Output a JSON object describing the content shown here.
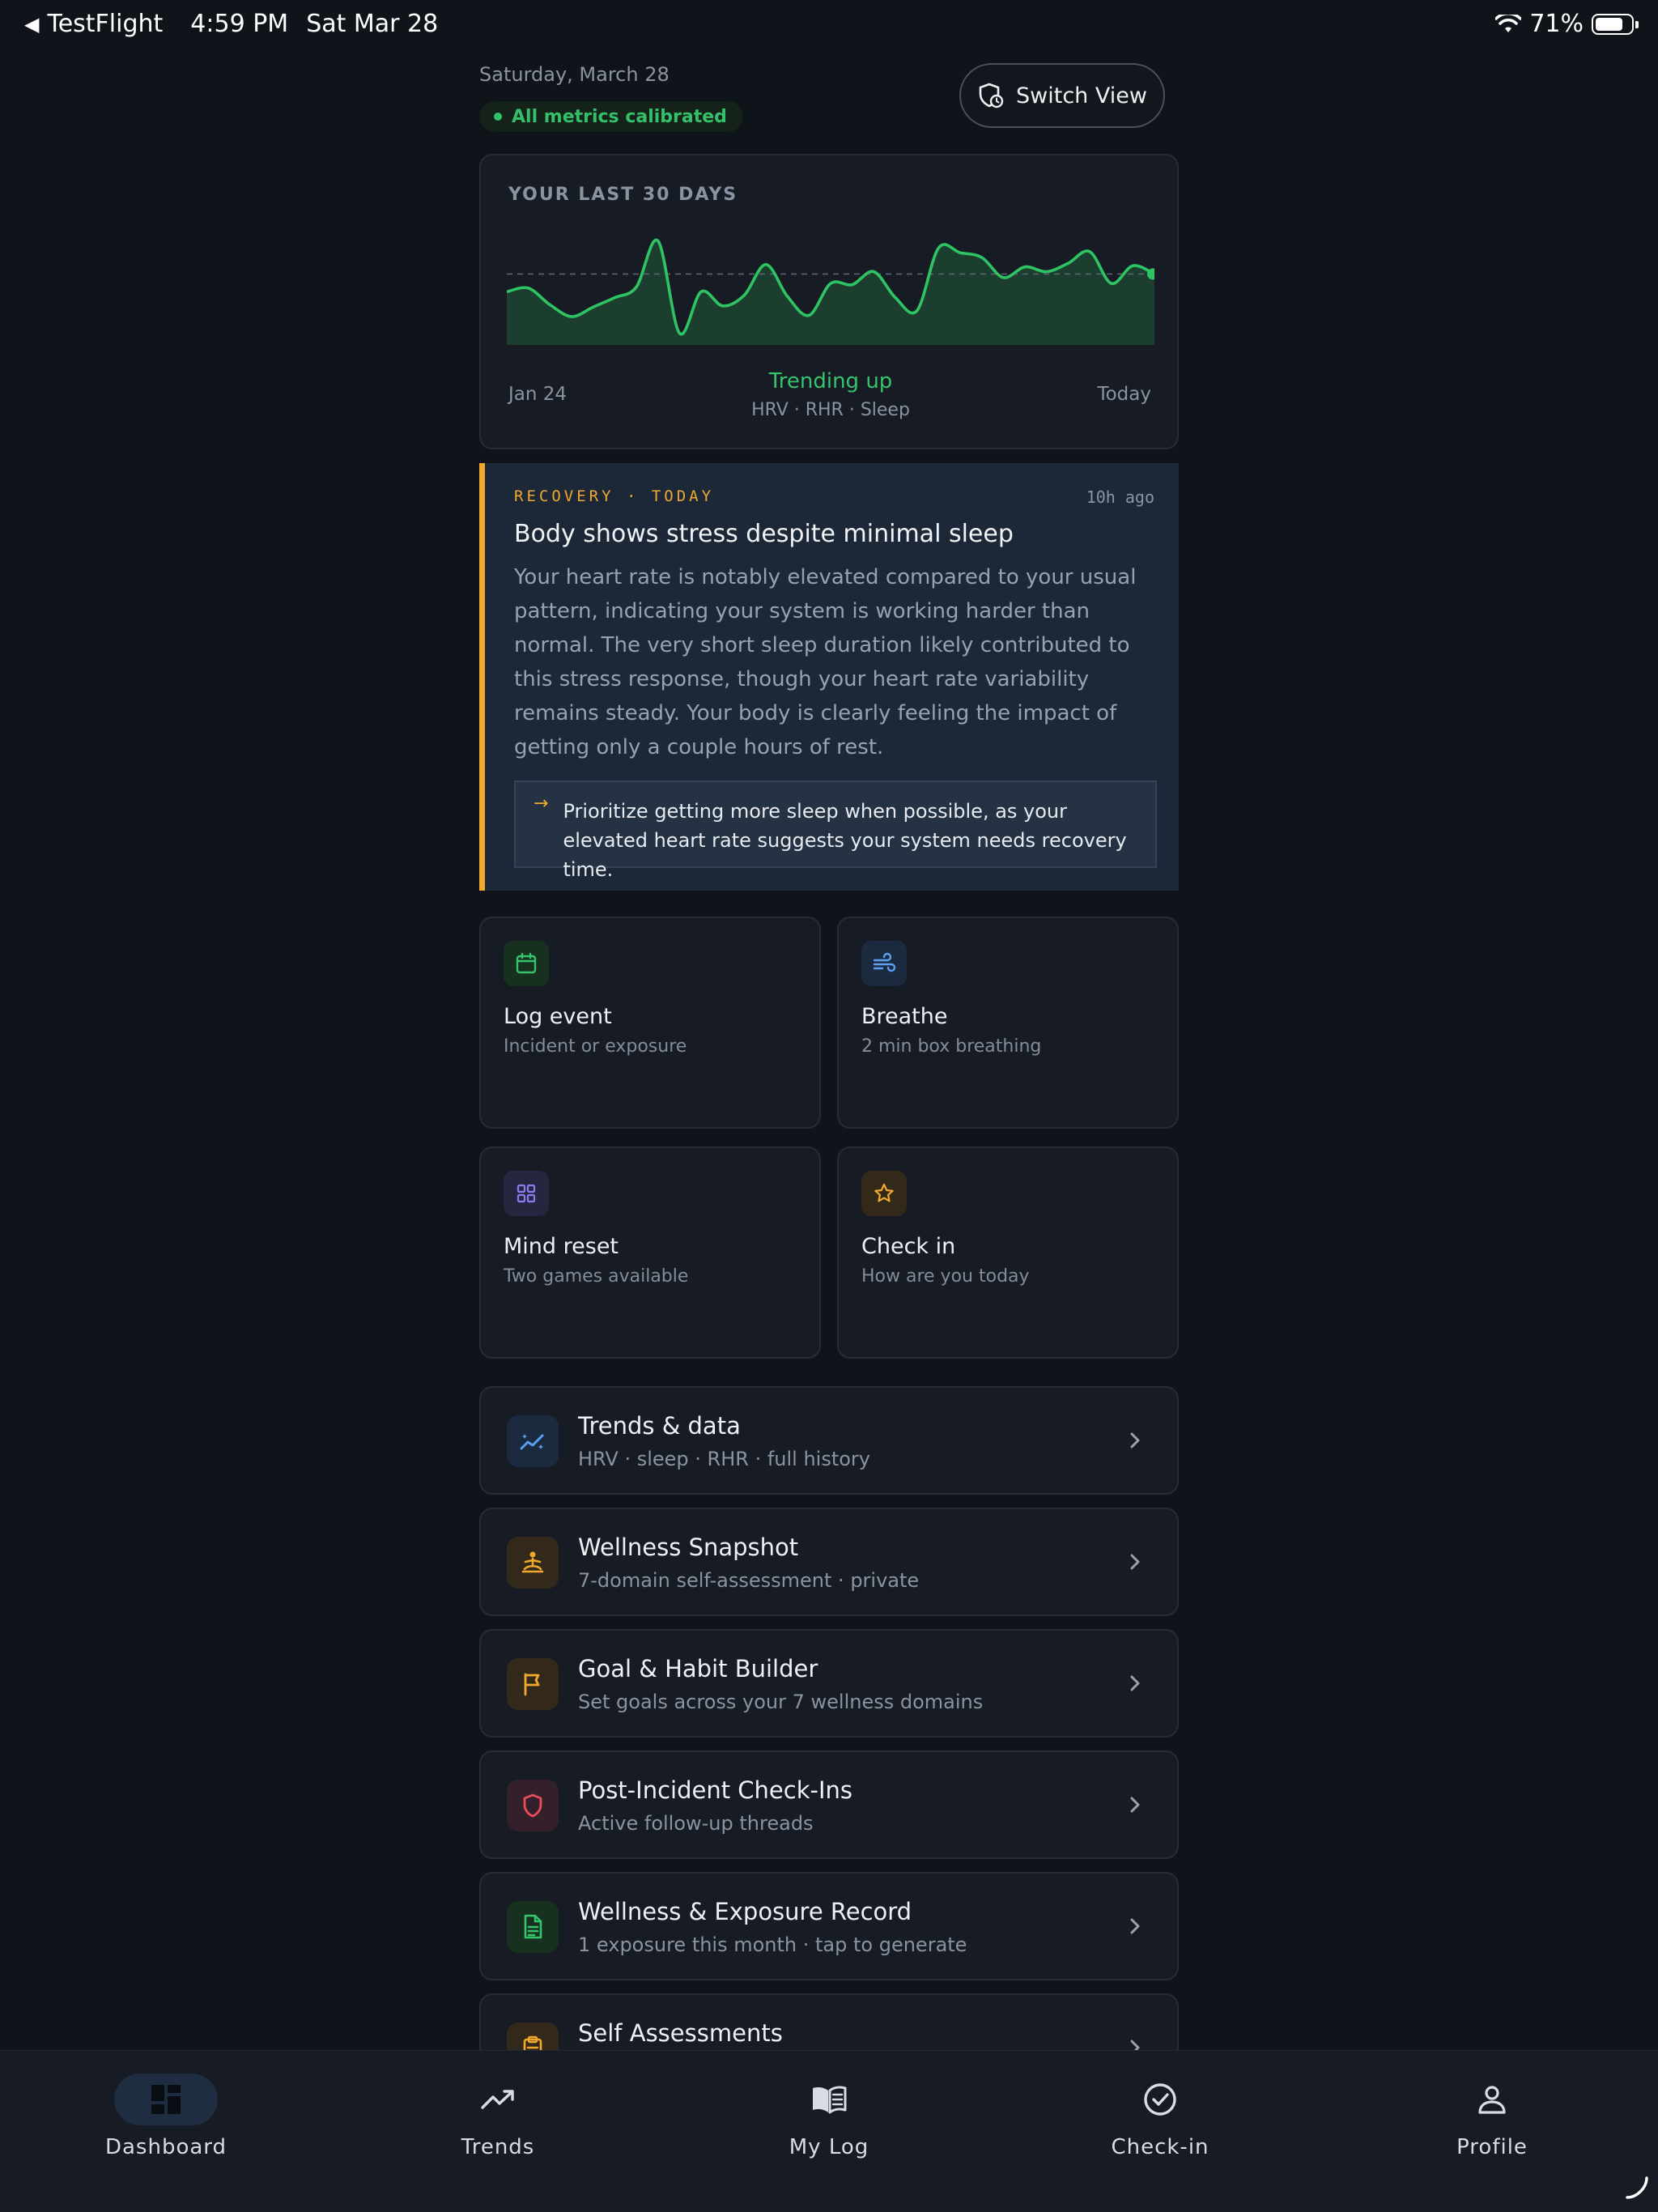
{
  "status_bar": {
    "back_app": "TestFlight",
    "time": "4:59 PM",
    "date": "Sat Mar 28",
    "battery": "71%",
    "battery_level": 0.71
  },
  "header": {
    "date": "Saturday, March 28",
    "calibration_badge": "All metrics calibrated",
    "switch_view_label": "Switch View"
  },
  "trend_card": {
    "kicker": "YOUR LAST 30 DAYS",
    "start_label": "Jan 24",
    "end_label": "Today",
    "trend_label": "Trending up",
    "metrics_label": "HRV · RHR · Sleep"
  },
  "chart_data": {
    "type": "area",
    "series": [
      {
        "values": [
          45,
          48,
          34,
          24,
          32,
          40,
          49,
          88,
          10,
          45,
          33,
          42,
          68,
          41,
          25,
          52,
          51,
          62,
          40,
          29,
          82,
          78,
          74,
          57,
          66,
          62,
          69,
          79,
          52,
          67,
          60
        ]
      }
    ],
    "reference_line": 60,
    "ylim": [
      0,
      100
    ],
    "colors": {
      "line": "#2fc463",
      "fill": "#1f4a33",
      "reference": "#5a6270"
    }
  },
  "insight": {
    "kicker": "RECOVERY · TODAY",
    "time_ago": "10h ago",
    "title": "Body shows stress despite minimal sleep",
    "body": "Your heart rate is notably elevated compared to your usual pattern, indicating your system is working harder than normal. The very short sleep duration likely contributed to this stress response, though your heart rate variability remains steady. Your body is clearly feeling the impact of getting only a couple hours of rest.",
    "action": "Prioritize getting more sleep when possible, as your elevated heart rate suggests your system needs recovery time.",
    "accent_color": "#f0a92c"
  },
  "tiles": [
    {
      "title": "Log event",
      "subtitle": "Incident or exposure",
      "icon": "calendar-icon"
    },
    {
      "title": "Breathe",
      "subtitle": "2 min box breathing",
      "icon": "wind-icon"
    },
    {
      "title": "Mind reset",
      "subtitle": "Two games available",
      "icon": "grid-icon"
    },
    {
      "title": "Check in",
      "subtitle": "How are you today",
      "icon": "star-icon"
    }
  ],
  "rows": [
    {
      "title": "Trends & data",
      "subtitle": "HRV · sleep · RHR · full history",
      "icon": "trend-sparkle-icon"
    },
    {
      "title": "Wellness Snapshot",
      "subtitle": "7-domain self-assessment · private",
      "icon": "meditation-icon"
    },
    {
      "title": "Goal & Habit Builder",
      "subtitle": "Set goals across your 7 wellness domains",
      "icon": "flag-icon"
    },
    {
      "title": "Post-Incident Check-Ins",
      "subtitle": "Active follow-up threads",
      "icon": "shield-icon"
    },
    {
      "title": "Wellness & Exposure Record",
      "subtitle": "1 exposure this month · tap to generate",
      "icon": "document-icon"
    },
    {
      "title": "Self Assessments",
      "subtitle": "",
      "icon": "clipboard-icon"
    }
  ],
  "tab_bar": [
    {
      "label": "Dashboard",
      "icon": "dashboard-icon",
      "active": true
    },
    {
      "label": "Trends",
      "icon": "trending-icon",
      "active": false
    },
    {
      "label": "My Log",
      "icon": "book-icon",
      "active": false
    },
    {
      "label": "Check-in",
      "icon": "check-circle-icon",
      "active": false
    },
    {
      "label": "Profile",
      "icon": "person-icon",
      "active": false
    }
  ]
}
